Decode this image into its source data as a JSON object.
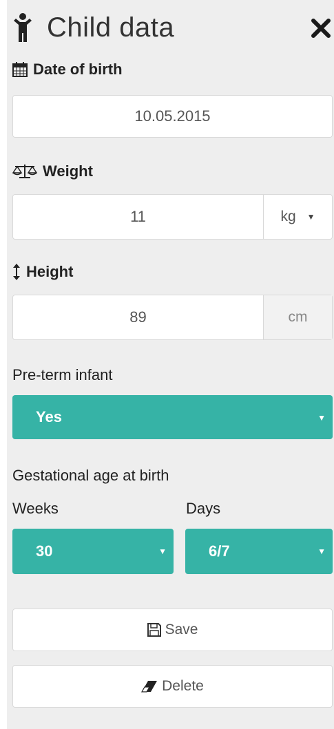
{
  "header": {
    "title": "Child data"
  },
  "dob": {
    "label": "Date of birth",
    "value": "10.05.2015"
  },
  "weight": {
    "label": "Weight",
    "value": "11",
    "unit": "kg"
  },
  "height": {
    "label": "Height",
    "value": "89",
    "unit": "cm"
  },
  "preterm": {
    "label": "Pre-term infant",
    "value": "Yes"
  },
  "gestational": {
    "label": "Gestational age at birth",
    "weeks_label": "Weeks",
    "weeks_value": "30",
    "days_label": "Days",
    "days_value": "6/7"
  },
  "actions": {
    "save_label": "Save",
    "delete_label": "Delete"
  },
  "colors": {
    "accent": "#36b3a6",
    "panel_bg": "#eeeeee"
  }
}
